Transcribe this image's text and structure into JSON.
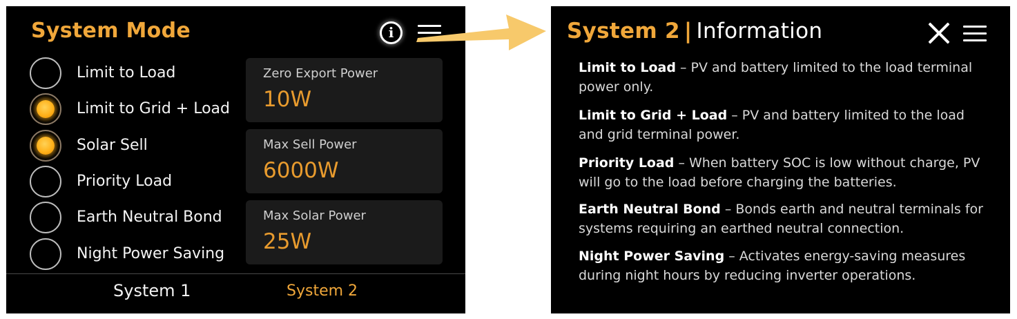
{
  "left_panel": {
    "title": "System Mode",
    "info_icon_glyph": "i",
    "modes": [
      {
        "label": "Limit to Load",
        "selected": false
      },
      {
        "label": "Limit to Grid + Load",
        "selected": true
      },
      {
        "label": "Solar Sell",
        "selected": true
      },
      {
        "label": "Priority Load",
        "selected": false
      },
      {
        "label": "Earth Neutral Bond",
        "selected": false
      },
      {
        "label": "Night Power Saving",
        "selected": false
      }
    ],
    "cards": [
      {
        "label": "Zero Export Power",
        "value": "10W"
      },
      {
        "label": "Max Sell Power",
        "value": "6000W"
      },
      {
        "label": "Max Solar Power",
        "value": "25W"
      }
    ],
    "tabs": [
      {
        "label": "System 1",
        "active": false
      },
      {
        "label": "System 2",
        "active": true
      }
    ]
  },
  "right_panel": {
    "title_system": "System 2",
    "title_separator": "|",
    "title_info": "Information",
    "entries": [
      {
        "term": "Limit to Load",
        "desc": " – PV and battery limited to the load terminal power only."
      },
      {
        "term": "Limit to Grid + Load",
        "desc": " – PV and battery limited to the load and grid terminal power."
      },
      {
        "term": "Priority Load",
        "desc": " – When battery SOC is low without charge, PV will go to the load before charging the batteries."
      },
      {
        "term": "Earth Neutral Bond",
        "desc": "  – Bonds earth and neutral terminals for systems requiring an earthed neutral connection."
      },
      {
        "term": "Night Power Saving",
        "desc": " – Activates energy-saving measures during night hours by reducing inverter operations."
      }
    ]
  },
  "colors": {
    "accent": "#f0a73a",
    "panel_bg": "#000000",
    "card_bg": "#1b1b1b",
    "arrow": "#f7c96b"
  },
  "icons": [
    "info-icon",
    "menu-icon",
    "close-icon",
    "arrow-icon"
  ]
}
